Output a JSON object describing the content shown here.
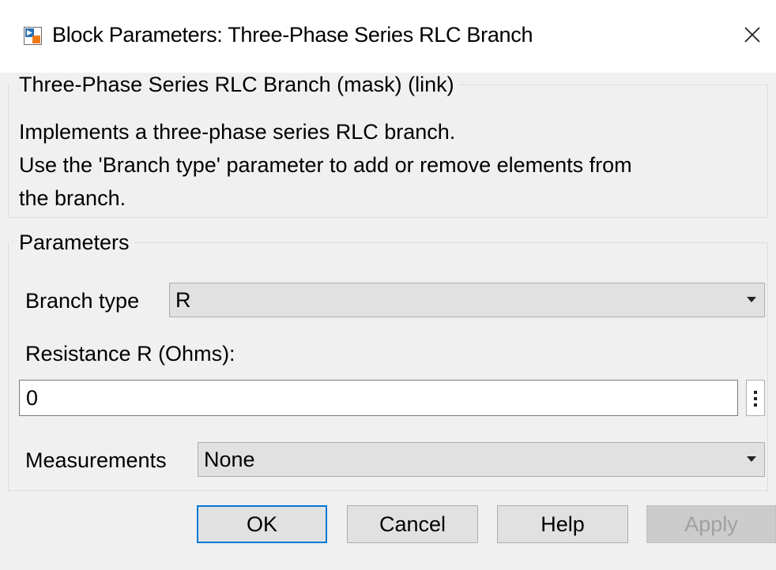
{
  "window": {
    "title": "Block Parameters: Three-Phase Series RLC Branch"
  },
  "description": {
    "legend": "Three-Phase Series RLC Branch (mask) (link)",
    "lines": [
      "Implements a three-phase series RLC branch.",
      "Use the 'Branch type' parameter to add or remove elements from",
      "the branch."
    ]
  },
  "parameters": {
    "legend": "Parameters",
    "branch_type": {
      "label": "Branch type",
      "value": "R"
    },
    "resistance": {
      "label": "Resistance R (Ohms):",
      "value": "0"
    },
    "measurements": {
      "label": "Measurements",
      "value": "None"
    }
  },
  "buttons": {
    "ok": "OK",
    "cancel": "Cancel",
    "help": "Help",
    "apply": "Apply"
  },
  "colors": {
    "default_button_border": "#0078d7",
    "icon_blue": "#2a6fb5",
    "icon_orange": "#f07a1a"
  },
  "icons": {
    "app": "simulink-block-icon",
    "close": "close-icon",
    "dropdown": "chevron-down-icon",
    "more": "vertical-ellipsis-icon"
  }
}
